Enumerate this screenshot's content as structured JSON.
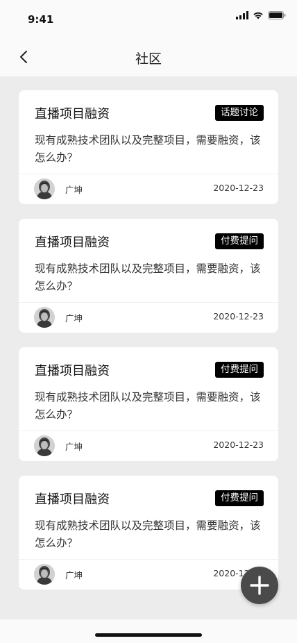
{
  "status_bar": {
    "time": "9:41",
    "icons": [
      "cellular-signal-icon",
      "wifi-icon",
      "battery-icon"
    ]
  },
  "nav": {
    "back_icon": "chevron-left-icon",
    "title": "社区"
  },
  "posts": [
    {
      "title": "直播项目融资",
      "tag": "话题讨论",
      "body": "现有成熟技术团队以及完整项目，需要融资，该怎么办？",
      "author": "广坤",
      "date": "2020-12-23"
    },
    {
      "title": "直播项目融资",
      "tag": "付费提问",
      "body": "现有成熟技术团队以及完整项目，需要融资，该怎么办？",
      "author": "广坤",
      "date": "2020-12-23"
    },
    {
      "title": "直播项目融资",
      "tag": "付费提问",
      "body": "现有成熟技术团队以及完整项目，需要融资，该怎么办？",
      "author": "广坤",
      "date": "2020-12-23"
    },
    {
      "title": "直播项目融资",
      "tag": "付费提问",
      "body": "现有成熟技术团队以及完整项目，需要融资，该怎么办？",
      "author": "广坤",
      "date": "2020-12-23"
    }
  ],
  "fab": {
    "icon": "plus-icon"
  },
  "colors": {
    "page_background": "#ececec",
    "card_background": "#ffffff",
    "tag_background": "#000000",
    "fab_background": "#4a4a4a"
  }
}
